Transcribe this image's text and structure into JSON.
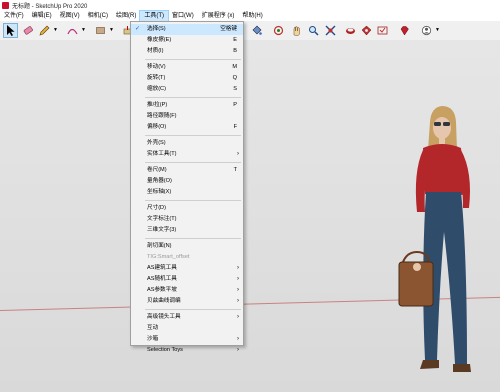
{
  "window": {
    "title": "无标题 - SketchUp Pro 2020"
  },
  "menubar": {
    "items": [
      "文件(F)",
      "编辑(E)",
      "视图(V)",
      "相机(C)",
      "绘图(R)",
      "工具(T)",
      "窗口(W)",
      "扩展程序 (x)",
      "帮助(H)"
    ]
  },
  "toolbar": {
    "icons": [
      "select-arrow-icon",
      "eraser-icon",
      "pencil-icon",
      "arc-icon",
      "rectangle-icon",
      "push-pull-icon",
      "move-icon",
      "paint-bucket-icon",
      "orbit-icon",
      "pan-icon",
      "zoom-icon",
      "zoom-extents-icon",
      "warehouse-icon",
      "extension-warehouse-icon",
      "sandbox-icon",
      "ruby-icon",
      "section-icon"
    ]
  },
  "menu": {
    "groups": [
      [
        {
          "label": "选择(S)",
          "shortcut": "空格键",
          "checked": true,
          "highlight": true
        },
        {
          "label": "橡皮擦(E)",
          "shortcut": "E"
        },
        {
          "label": "材质(I)",
          "shortcut": "B"
        }
      ],
      [
        {
          "label": "移动(V)",
          "shortcut": "M"
        },
        {
          "label": "旋转(T)",
          "shortcut": "Q"
        },
        {
          "label": "缩放(C)",
          "shortcut": "S"
        }
      ],
      [
        {
          "label": "推/拉(P)",
          "shortcut": "P"
        },
        {
          "label": "路径跟随(F)",
          "shortcut": ""
        },
        {
          "label": "偏移(O)",
          "shortcut": "F"
        }
      ],
      [
        {
          "label": "外壳(S)",
          "shortcut": ""
        },
        {
          "label": "实体工具(T)",
          "shortcut": "",
          "submenu": true
        }
      ],
      [
        {
          "label": "卷尺(M)",
          "shortcut": "T"
        },
        {
          "label": "量角器(O)",
          "shortcut": ""
        },
        {
          "label": "坐标轴(X)",
          "shortcut": ""
        }
      ],
      [
        {
          "label": "尺寸(D)",
          "shortcut": ""
        },
        {
          "label": "文字标注(T)",
          "shortcut": ""
        },
        {
          "label": "三维文字(3)",
          "shortcut": ""
        }
      ],
      [
        {
          "label": "剖切面(N)",
          "shortcut": ""
        },
        {
          "label": "TIG:Smart_offset",
          "shortcut": "",
          "disabled": true
        },
        {
          "label": "AS建筑工具",
          "shortcut": "",
          "submenu": true
        },
        {
          "label": "AS随机工具",
          "shortcut": "",
          "submenu": true
        },
        {
          "label": "AS参数平坡",
          "shortcut": "",
          "submenu": true
        },
        {
          "label": "贝兹曲线调编",
          "shortcut": "",
          "submenu": true
        }
      ],
      [
        {
          "label": "高级镜头工具",
          "shortcut": "",
          "submenu": true
        },
        {
          "label": "互动",
          "shortcut": ""
        },
        {
          "label": "沙箱",
          "shortcut": "",
          "submenu": true
        },
        {
          "label": "Selection Toys",
          "shortcut": "",
          "submenu": true
        }
      ]
    ]
  },
  "colors": {
    "canvas": "#dedede",
    "axis_red": "#c76a6a",
    "highlight": "#cce8ff"
  }
}
